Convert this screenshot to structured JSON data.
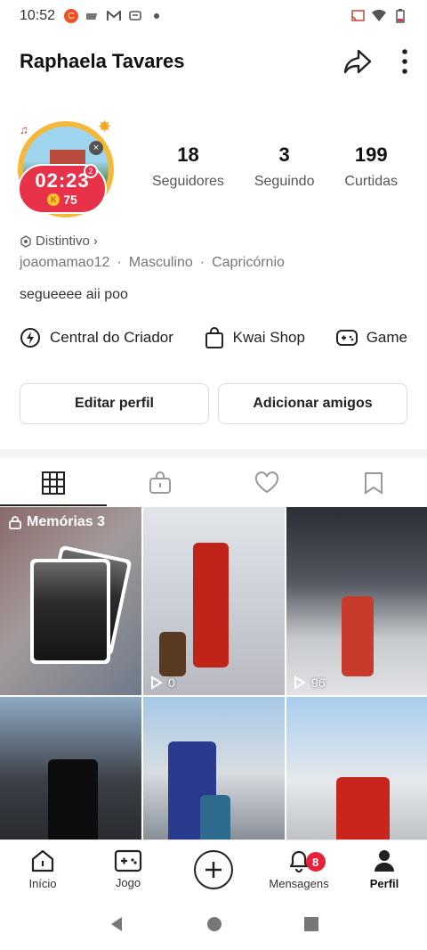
{
  "status_bar": {
    "time": "10:52"
  },
  "header": {
    "username": "Raphaela Tavares"
  },
  "avatar": {
    "timer": "02:23",
    "coins": "75",
    "small_badge": "2"
  },
  "stats": [
    {
      "num": "18",
      "label": "Seguidores"
    },
    {
      "num": "3",
      "label": "Seguindo"
    },
    {
      "num": "199",
      "label": "Curtidas"
    }
  ],
  "profile": {
    "badge_label": "Distintivo",
    "handle": "joaomamao12",
    "gender": "Masculino",
    "sign": "Capricórnio",
    "bio": "segueeee aii poo"
  },
  "shortcuts": [
    {
      "label": "Central do Criador",
      "icon": "lightning-icon"
    },
    {
      "label": "Kwai Shop",
      "icon": "shopping-bag-icon"
    },
    {
      "label": "Game",
      "icon": "gamepad-icon"
    }
  ],
  "actions": {
    "edit": "Editar perfil",
    "add_friends": "Adicionar amigos"
  },
  "grid": {
    "memories_title": "Memórias 3",
    "videos": [
      {
        "views": "0"
      },
      {
        "views": "96"
      }
    ]
  },
  "bottom_nav": {
    "inicio": "Início",
    "jogo": "Jogo",
    "mensagens": "Mensagens",
    "mensagens_badge": "8",
    "perfil": "Perfil"
  }
}
